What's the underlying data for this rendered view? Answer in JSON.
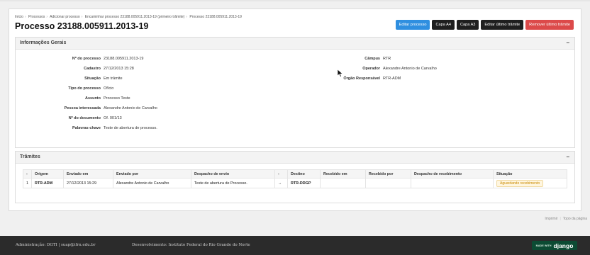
{
  "breadcrumb": [
    "Início",
    "Processos",
    "Adicionar processo",
    "Encaminhar processo 23188.005911.2013-19 (primeiro trâmite)",
    "Processo 23188.005911.2013-19"
  ],
  "page_title": "Processo 23188.005911.2013-19",
  "actions": {
    "edit": "Editar processo",
    "capa_a4": "Capa A4",
    "capa_a3": "Capa A3",
    "edit_last": "Editar último trâmite",
    "remove_last": "Remover último trâmite"
  },
  "info": {
    "title": "Informações Gerais",
    "collapse": "−",
    "left": [
      {
        "label": "Nº do processo",
        "value": "23188.005911.2013-19"
      },
      {
        "label": "Cadastro",
        "value": "27/12/2013 15:28"
      },
      {
        "label": "Situação",
        "value": "Em trâmite"
      },
      {
        "label": "Tipo do processo",
        "value": "Ofício"
      },
      {
        "label": "Assunto",
        "value": "Processo Teste"
      },
      {
        "label": "Pessoa interessada",
        "value": "Alexandre Antonio de Carvalho"
      },
      {
        "label": "Nº do documento",
        "value": "Of. 001/13"
      },
      {
        "label": "Palavras-chave",
        "value": "Teste de abertura de processo."
      }
    ],
    "right": [
      {
        "label": "Câmpus",
        "value": "RTR"
      },
      {
        "label": "Operador",
        "value": "Alexandre Antonio de Carvalho"
      },
      {
        "label": "Órgão Responsável",
        "value": "RTR-ADM"
      }
    ]
  },
  "tramites": {
    "title": "Trâmites",
    "collapse": "−",
    "headers": [
      "-",
      "Origem",
      "Enviado em",
      "Enviado por",
      "Despacho de envio",
      "-",
      "Destino",
      "Recebido em",
      "Recebido por",
      "Despacho de recebimento",
      "Situação"
    ],
    "rows": [
      {
        "n": "1",
        "origem": "RTR-ADM",
        "enviado_em": "27/12/2013 15:29",
        "enviado_por": "Alexandre Antonio de Carvalho",
        "despacho_envio": "Teste de abertura de Processo.",
        "arrow": "→",
        "destino": "RTR-DDGP",
        "recebido_em": "",
        "recebido_por": "",
        "despacho_recebimento": "",
        "situacao": "Aguardando recebimento"
      }
    ]
  },
  "footer_links": {
    "print": "Imprimir",
    "top": "Topo da página"
  },
  "footer": {
    "admin": "Administração: DGTI | suap@ifrn.edu.br",
    "dev": "Desenvolvimento: Instituto Federal do Rio Grande do Norte",
    "badge_small": "MADE WITH",
    "badge_big": "django"
  },
  "colors": {
    "primary": "#2f8fe0",
    "danger": "#dc4a4a",
    "dark": "#1f1f1f",
    "footer_bg": "#2b2b2b",
    "django_green": "#0c4b33",
    "warning_text": "#c98a00"
  }
}
